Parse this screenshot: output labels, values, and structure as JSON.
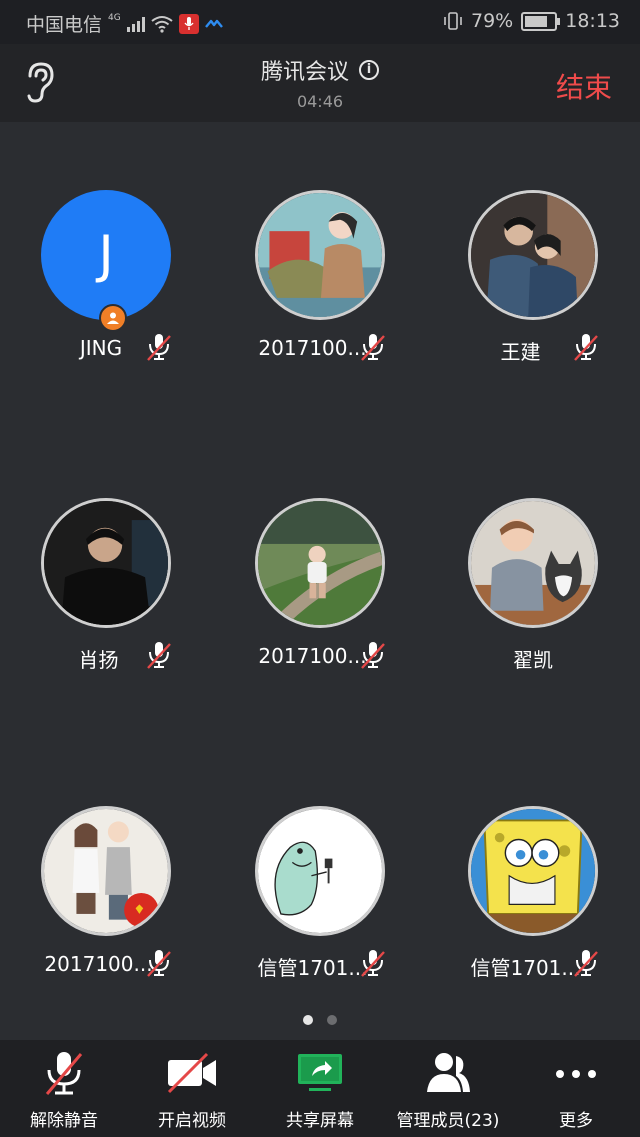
{
  "status_bar": {
    "carrier": "中国电信",
    "network": "4G",
    "battery": "79%",
    "battery_level": 0.79,
    "time": "18:13"
  },
  "header": {
    "title": "腾讯会议",
    "duration": "04:46",
    "end_label": "结束"
  },
  "participants": [
    {
      "name": "JING",
      "avatar_letter": "J",
      "avatar_type": "letter",
      "avatar_color": "#1f7cf6",
      "is_host": true,
      "muted": true
    },
    {
      "name": "2017100...",
      "avatar_type": "illustration",
      "muted": true
    },
    {
      "name": "王建",
      "avatar_type": "photo",
      "muted": true
    },
    {
      "name": "肖扬",
      "avatar_type": "photo",
      "muted": true
    },
    {
      "name": "2017100...",
      "avatar_type": "photo",
      "muted": true
    },
    {
      "name": "翟凯",
      "avatar_type": "photo",
      "muted": false
    },
    {
      "name": "2017100...",
      "avatar_type": "illustration",
      "muted": true
    },
    {
      "name": "信管1701...",
      "avatar_type": "illustration",
      "muted": true
    },
    {
      "name": "信管1701...",
      "avatar_type": "cartoon",
      "muted": true
    }
  ],
  "pager": {
    "pages": 2,
    "current": 1
  },
  "toolbar": {
    "unmute_label": "解除静音",
    "video_label": "开启视频",
    "share_label": "共享屏幕",
    "members_label": "管理成员(23)",
    "more_label": "更多"
  },
  "colors": {
    "background": "#2b2d31",
    "end_red": "#ef4b4b",
    "accent_blue": "#1f7cf6",
    "share_green": "#21b35a",
    "host_orange": "#f07f27"
  }
}
